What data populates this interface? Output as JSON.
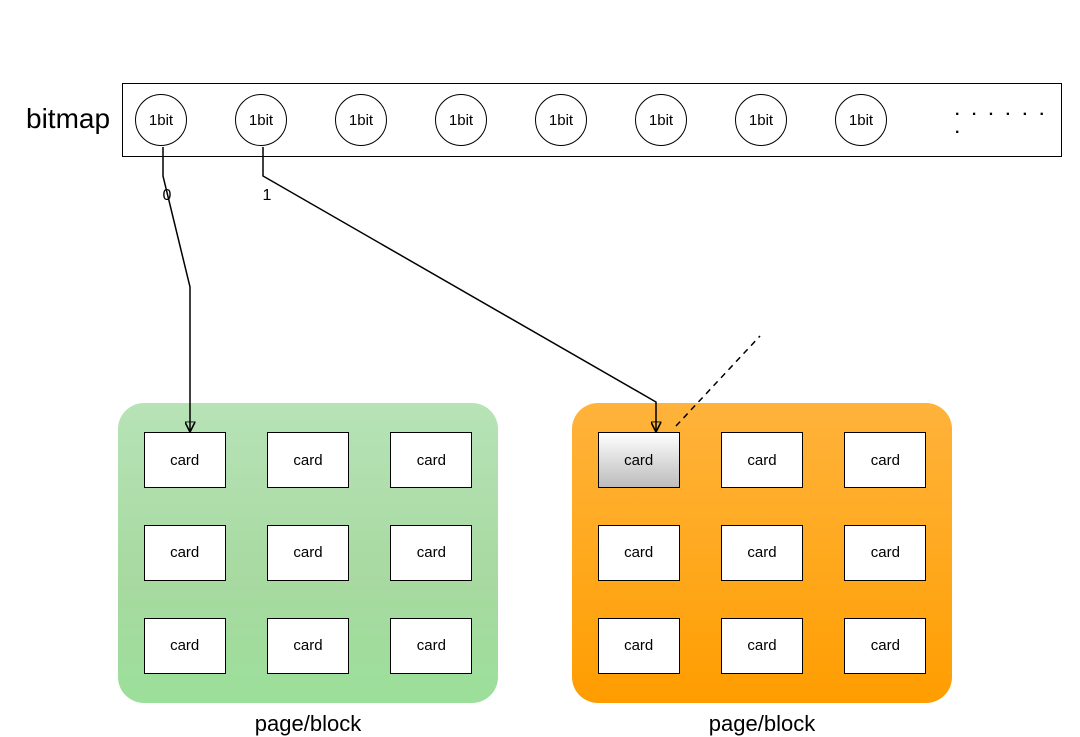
{
  "header": {
    "label": "bitmap"
  },
  "bits": {
    "label": "1bit",
    "count": 8,
    "ellipsis": ". . . . . . .",
    "numbers": [
      "0",
      "1"
    ]
  },
  "panels": {
    "green": {
      "label": "page/block",
      "cards": [
        "card",
        "card",
        "card",
        "card",
        "card",
        "card",
        "card",
        "card",
        "card"
      ]
    },
    "orange": {
      "label": "page/block",
      "cards": [
        "card",
        "card",
        "card",
        "card",
        "card",
        "card",
        "card",
        "card",
        "card"
      ]
    }
  }
}
